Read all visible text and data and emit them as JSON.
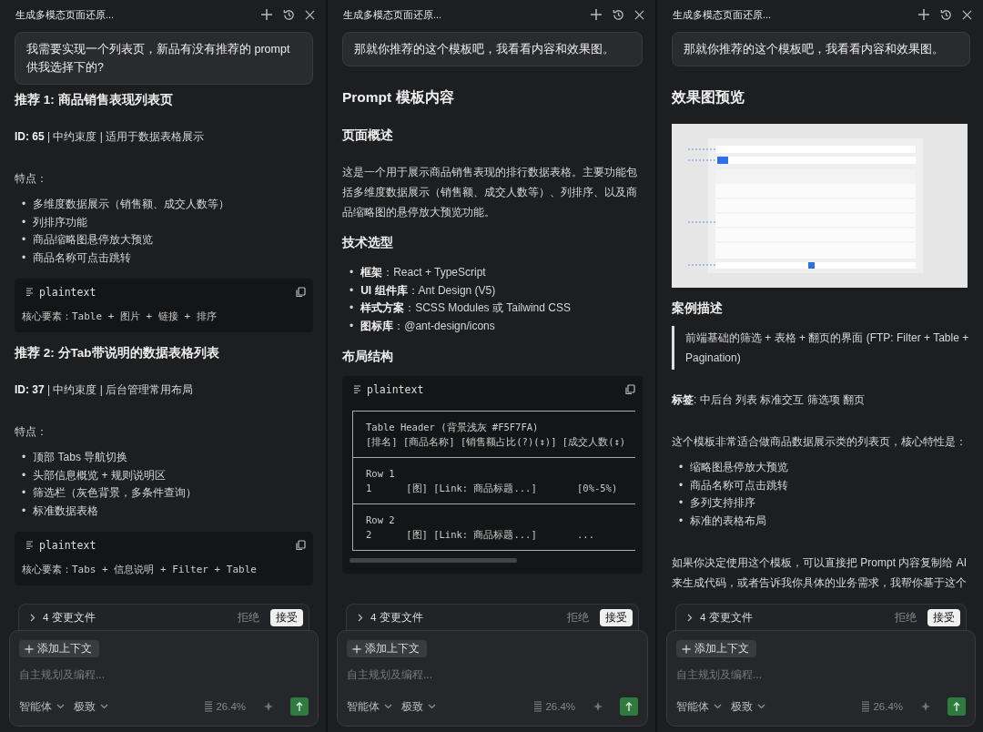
{
  "panels": [
    {
      "title": "生成多模态页面还原...",
      "blocks": [
        {
          "kind": "user",
          "text": "我需要实现一个列表页，新品有没有推荐的 prompt 供我选择下的?"
        },
        {
          "kind": "h3",
          "text": "推荐 1: 商品销售表现列表页"
        },
        {
          "kind": "p",
          "text": "**ID: 65** | 中约束度 | 适用于数据表格展示"
        },
        {
          "kind": "p",
          "text": "特点："
        },
        {
          "kind": "list",
          "marker": "•",
          "items": [
            "多维度数据展示（销售额、成交人数等）",
            "列排序功能",
            "商品缩略图悬停放大预览",
            "商品名称可点击跳转"
          ]
        },
        {
          "kind": "code",
          "language": "plaintext",
          "text": "核心要素：Table + 图片 + 链接 + 排序"
        },
        {
          "kind": "h3",
          "text": "推荐 2: 分Tab带说明的数据表格列表"
        },
        {
          "kind": "p",
          "text": "**ID: 37** | 中约束度 | 后台管理常用布局"
        },
        {
          "kind": "p",
          "text": "特点："
        },
        {
          "kind": "list",
          "marker": "•",
          "items": [
            "顶部 Tabs 导航切换",
            "头部信息概览 + 规则说明区",
            "筛选栏（灰色背景，多条件查询）",
            "标准数据表格"
          ]
        },
        {
          "kind": "code",
          "language": "plaintext",
          "text": "核心要素：Tabs + 信息说明 + Filter + Table"
        }
      ],
      "changes": {
        "label": "4 变更文件",
        "reject": "拒绝",
        "accept": "接受"
      },
      "composer": {
        "add_context": "添加上下文",
        "placeholder": "自主规划及编程...",
        "agent": "智能体",
        "mode": "极致",
        "usage": "26.4%"
      }
    },
    {
      "title": "生成多模态页面还原...",
      "blocks": [
        {
          "kind": "user",
          "text": "那就你推荐的这个模板吧，我看看内容和效果图。"
        },
        {
          "kind": "h2",
          "text": "Prompt 模板内容"
        },
        {
          "kind": "h3",
          "text": "页面概述"
        },
        {
          "kind": "p",
          "text": "这是一个用于展示商品销售表现的排行数据表格。主要功能包括多维度数据展示（销售额、成交人数等）、列排序、以及商品缩略图的悬停放大预览功能。"
        },
        {
          "kind": "h3",
          "text": "技术选型"
        },
        {
          "kind": "list",
          "marker": "•",
          "items": [
            "**框架**：React + TypeScript",
            "**UI 组件库**：Ant Design (V5)",
            "**样式方案**：SCSS Modules 或 Tailwind CSS",
            "**图标库**：@ant-design/icons"
          ]
        },
        {
          "kind": "h3",
          "text": "布局结构"
        },
        {
          "kind": "layout_code",
          "language": "plaintext",
          "sections": [
            [
              "Table Header (背景浅灰 #F5F7FA)",
              "[排名] [商品名称] [销售额占比(?)(↕)] [成交人数(↕)"
            ],
            [
              "Row 1",
              "1      [图] [Link: 商品标题...]       [0%-5%)"
            ],
            [
              "Row 2",
              "2      [图] [Link: 商品标题...]       ..."
            ]
          ]
        }
      ],
      "changes": {
        "label": "4 变更文件",
        "reject": "拒绝",
        "accept": "接受"
      },
      "composer": {
        "add_context": "添加上下文",
        "placeholder": "自主规划及编程...",
        "agent": "智能体",
        "mode": "极致",
        "usage": "26.4%"
      }
    },
    {
      "title": "生成多模态页面还原...",
      "blocks": [
        {
          "kind": "user",
          "text": "那就你推荐的这个模板吧，我看看内容和效果图。"
        },
        {
          "kind": "h2",
          "text": "效果图预览"
        },
        {
          "kind": "picture"
        },
        {
          "kind": "h3",
          "text": "案例描述"
        },
        {
          "kind": "quote",
          "text": "前端基础的筛选 + 表格 + 翻页的界面 (FTP: Filter + Table + Pagination)"
        },
        {
          "kind": "p",
          "text": "**标签**: 中后台 列表 标准交互 筛选项 翻页"
        },
        {
          "kind": "p",
          "text": "这个模板非常适合做商品数据展示类的列表页，核心特性是："
        },
        {
          "kind": "list",
          "marker": "•",
          "items": [
            "缩略图悬停放大预览",
            "商品名称可点击跳转",
            "多列支持排序",
            "标准的表格布局"
          ]
        },
        {
          "kind": "p",
          "text": "如果你决定使用这个模板，可以直接把 Prompt 内容复制给 AI 来生成代码，或者告诉我你具体的业务需求，我帮你基于这个"
        }
      ],
      "changes": {
        "label": "4 变更文件",
        "reject": "拒绝",
        "accept": "接受"
      },
      "composer": {
        "add_context": "添加上下文",
        "placeholder": "自主规划及编程...",
        "agent": "智能体",
        "mode": "极致",
        "usage": "26.4%"
      }
    }
  ]
}
